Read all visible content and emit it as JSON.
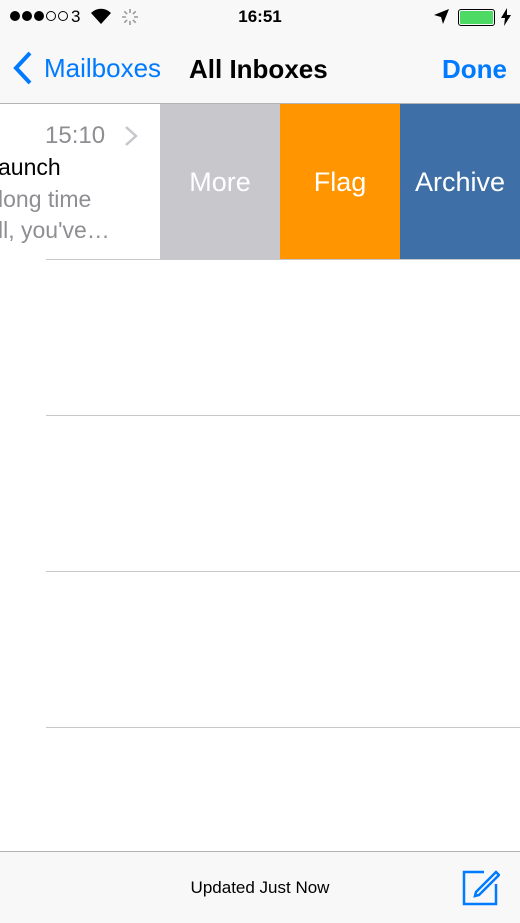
{
  "status_bar": {
    "carrier": "3",
    "signal_bars_filled": 3,
    "signal_bars_total": 5,
    "time": "16:51",
    "battery_percent": 100,
    "battery_color": "#4cd964"
  },
  "nav": {
    "back_label": "Mailboxes",
    "title": "All Inboxes",
    "done_label": "Done",
    "accent": "#007aff"
  },
  "message": {
    "time": "15:10",
    "subject": "aunch",
    "preview_line1": "long time",
    "preview_line2": "ll, you've…"
  },
  "actions": [
    {
      "label": "More",
      "color": "#c7c7cc"
    },
    {
      "label": "Flag",
      "color": "#ff9500"
    },
    {
      "label": "Archive",
      "color": "#3e70a7"
    }
  ],
  "toolbar": {
    "status": "Updated Just Now"
  }
}
